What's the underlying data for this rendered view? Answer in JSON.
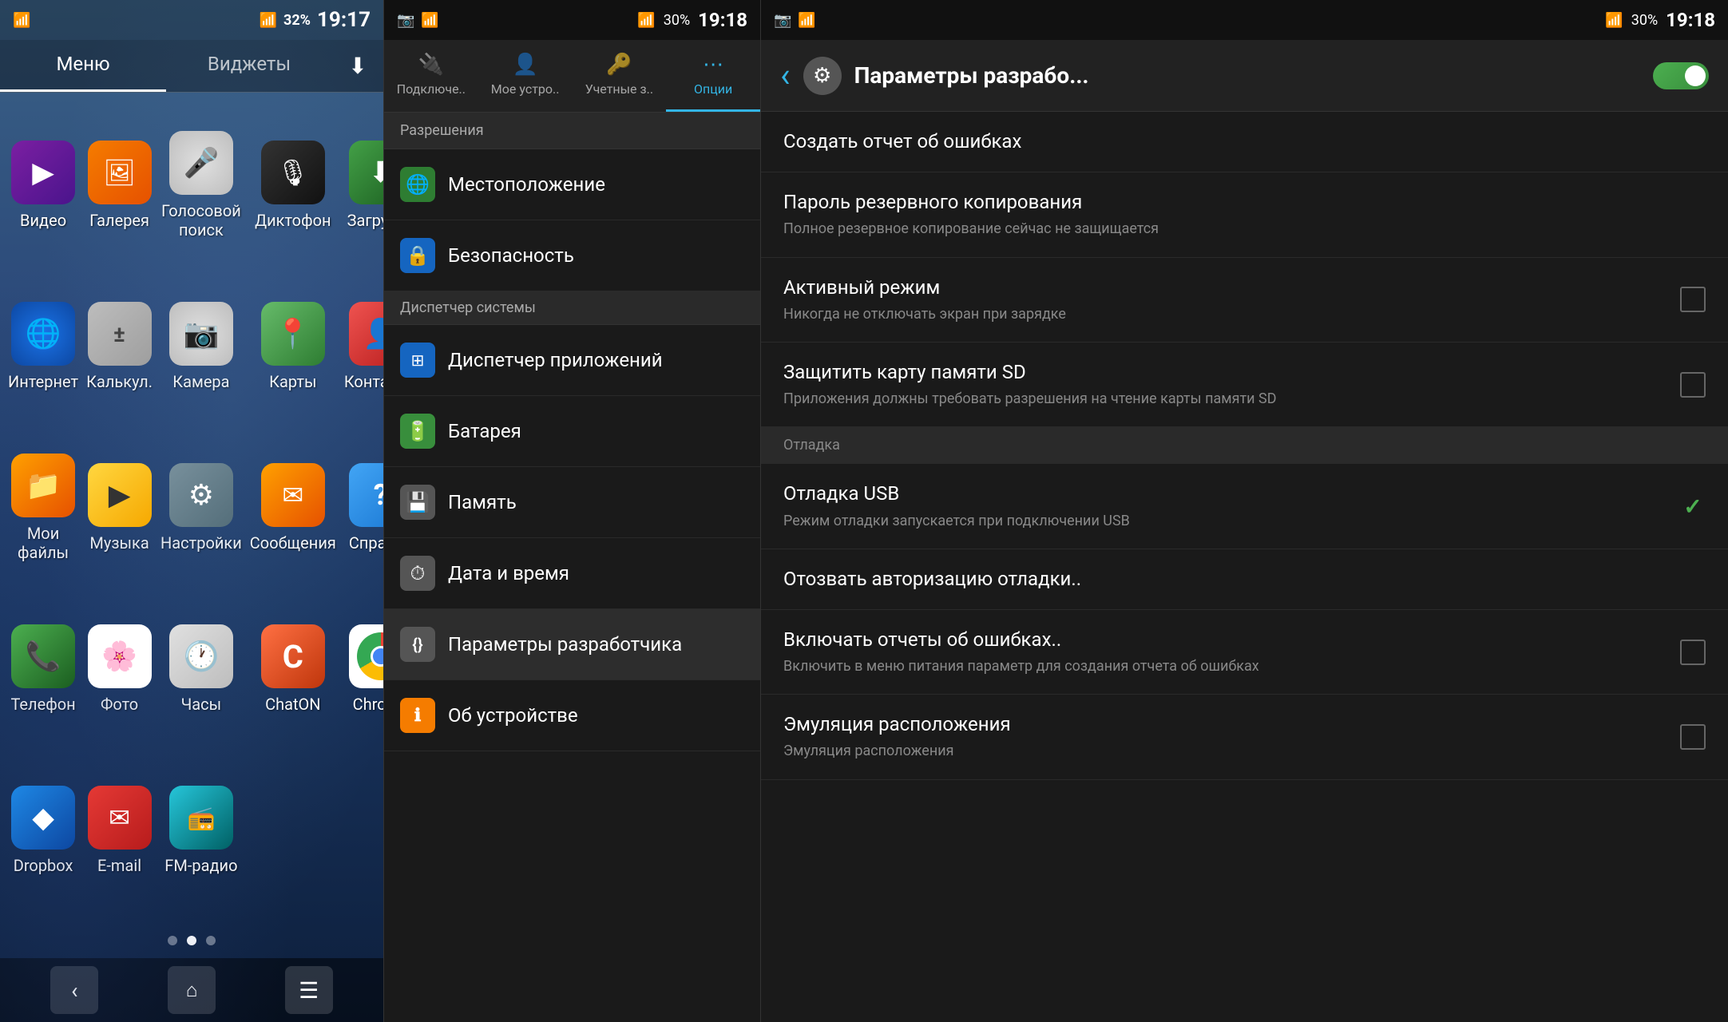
{
  "panel1": {
    "status_bar": {
      "time": "19:17",
      "battery_percent": "32%",
      "wifi": true,
      "signal": true
    },
    "tabs": [
      {
        "label": "Меню",
        "active": true
      },
      {
        "label": "Виджеты",
        "active": false
      }
    ],
    "apps": [
      {
        "id": "video",
        "label": "Видео",
        "icon": "▶",
        "style": "video-icon"
      },
      {
        "id": "gallery",
        "label": "Галерея",
        "icon": "🖼",
        "style": "gallery-icon"
      },
      {
        "id": "voice",
        "label": "Голосовой поиск",
        "icon": "🎤",
        "style": "voice-icon"
      },
      {
        "id": "dictaphone",
        "label": "Диктофон",
        "icon": "🎙",
        "style": "dictaphone-icon"
      },
      {
        "id": "downloads",
        "label": "Загрузки",
        "icon": "⬇",
        "style": "downloads-icon"
      },
      {
        "id": "internet",
        "label": "Интернет",
        "icon": "🌐",
        "style": "internet-icon"
      },
      {
        "id": "calculator",
        "label": "Калькул.",
        "icon": "±",
        "style": "calc-icon"
      },
      {
        "id": "camera",
        "label": "Камера",
        "icon": "📷",
        "style": "camera-icon"
      },
      {
        "id": "maps",
        "label": "Карты",
        "icon": "📍",
        "style": "maps-icon"
      },
      {
        "id": "contacts",
        "label": "Контакты",
        "icon": "👤",
        "style": "contacts-icon"
      },
      {
        "id": "myfiles",
        "label": "Мои файлы",
        "icon": "📁",
        "style": "files-icon"
      },
      {
        "id": "music",
        "label": "Музыка",
        "icon": "♪",
        "style": "music-icon"
      },
      {
        "id": "settings",
        "label": "Настройки",
        "icon": "⚙",
        "style": "bg-settings"
      },
      {
        "id": "messages",
        "label": "Сообщения",
        "icon": "✉",
        "style": "bg-yellow-msg"
      },
      {
        "id": "help",
        "label": "Справка",
        "icon": "?",
        "style": "bg-blue-help"
      },
      {
        "id": "phone",
        "label": "Телефон",
        "icon": "📞",
        "style": "phone-icon"
      },
      {
        "id": "photos",
        "label": "Фото",
        "icon": "🌸",
        "style": "photos-icon"
      },
      {
        "id": "clock",
        "label": "Часы",
        "icon": "🕐",
        "style": "clock-icon"
      },
      {
        "id": "chaton",
        "label": "ChatON",
        "icon": "C",
        "style": "chaton-icon"
      },
      {
        "id": "chrome",
        "label": "Chrome",
        "icon": "chrome",
        "style": "chrome-icon"
      },
      {
        "id": "dropbox",
        "label": "Dropbox",
        "icon": "◆",
        "style": "dropbox-icon"
      },
      {
        "id": "email",
        "label": "E-mail",
        "icon": "✉",
        "style": "email-icon"
      },
      {
        "id": "fmradio",
        "label": "FM-радио",
        "icon": "📻",
        "style": "fmradio-icon"
      }
    ],
    "page_dots": [
      {
        "active": false
      },
      {
        "active": true
      },
      {
        "active": false
      }
    ]
  },
  "panel2": {
    "status_bar": {
      "time": "19:18",
      "battery_percent": "30%"
    },
    "tabs": [
      {
        "id": "connect",
        "label": "Подключе..",
        "icon": "🔌",
        "active": false
      },
      {
        "id": "device",
        "label": "Мое устро..",
        "icon": "👤",
        "active": false
      },
      {
        "id": "accounts",
        "label": "Учетные з..",
        "icon": "🔑",
        "active": false
      },
      {
        "id": "options",
        "label": "Опции",
        "icon": "⋯",
        "active": true
      }
    ],
    "section_header": "Разрешения",
    "items": [
      {
        "id": "location",
        "label": "Местоположение",
        "icon": "🌐",
        "icon_style": "icon-location",
        "sub": ""
      },
      {
        "id": "security",
        "label": "Безопасность",
        "icon": "🔒",
        "icon_style": "icon-security",
        "sub": ""
      },
      {
        "id": "sysmanager",
        "label": "Диспетчер системы",
        "icon": "",
        "icon_style": "",
        "sub": "",
        "section": true
      },
      {
        "id": "appmanager",
        "label": "Диспетчер приложений",
        "icon": "⊞",
        "icon_style": "icon-apps",
        "sub": ""
      },
      {
        "id": "battery",
        "label": "Батарея",
        "icon": "🔋",
        "icon_style": "icon-battery",
        "sub": ""
      },
      {
        "id": "memory",
        "label": "Память",
        "icon": "💾",
        "icon_style": "icon-memory",
        "sub": ""
      },
      {
        "id": "datetime",
        "label": "Дата и время",
        "icon": "⏱",
        "icon_style": "icon-datetime",
        "sub": ""
      },
      {
        "id": "developer",
        "label": "Параметры разработчика",
        "icon": "{}",
        "icon_style": "icon-dev",
        "sub": ""
      },
      {
        "id": "about",
        "label": "Об устройстве",
        "icon": "ℹ",
        "icon_style": "icon-about",
        "sub": ""
      }
    ]
  },
  "panel3": {
    "status_bar": {
      "time": "19:18",
      "battery_percent": "30%"
    },
    "header": {
      "title": "Параметры разрабо...",
      "back_label": "‹",
      "switch_on": true
    },
    "items": [
      {
        "id": "create-report",
        "label": "Создать отчет об ошибках",
        "sub": "",
        "checkbox": false,
        "has_checkbox": false
      },
      {
        "id": "backup-password",
        "label": "Пароль резервного копирования",
        "sub": "Полное резервное копирование сейчас не защищается",
        "checkbox": false,
        "has_checkbox": false
      },
      {
        "id": "active-mode",
        "label": "Активный режим",
        "sub": "Никогда не отключать экран при зарядке",
        "checkbox": false,
        "has_checkbox": true
      },
      {
        "id": "protect-sd",
        "label": "Защитить карту памяти SD",
        "sub": "Приложения должны требовать разрешения на чтение карты памяти SD",
        "checkbox": false,
        "has_checkbox": true
      },
      {
        "id": "debug-section",
        "label": "Отладка",
        "is_section": true
      },
      {
        "id": "usb-debug",
        "label": "Отладка USB",
        "sub": "Режим отладки запускается при подключении USB",
        "checkbox": true,
        "has_checkbox": true,
        "checkbox_style": "green"
      },
      {
        "id": "revoke-auth",
        "label": "Отозвать авторизацию отладки..",
        "sub": "",
        "checkbox": false,
        "has_checkbox": false
      },
      {
        "id": "error-reports",
        "label": "Включать отчеты об ошибках..",
        "sub": "Включить в меню питания параметр для создания отчета об ошибках",
        "checkbox": false,
        "has_checkbox": true
      },
      {
        "id": "emulation",
        "label": "Эмуляция расположения",
        "sub": "Эмуляция расположения",
        "checkbox": false,
        "has_checkbox": true
      }
    ]
  }
}
